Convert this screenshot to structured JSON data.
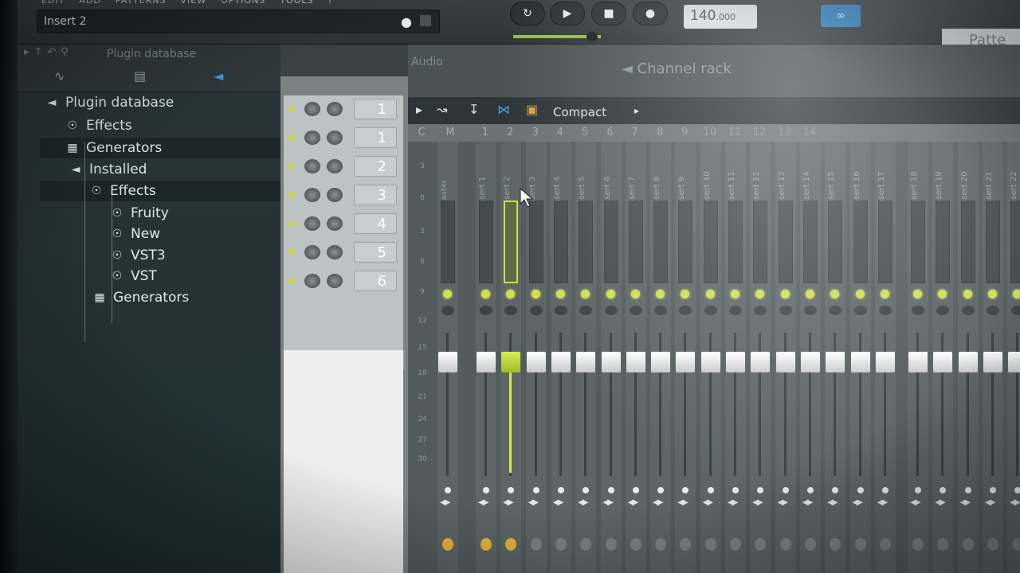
{
  "menu": [
    "EDIT",
    "ADD",
    "PATTERNS",
    "VIEW",
    "OPTIONS",
    "TOOLS",
    "?"
  ],
  "hint_bar": {
    "text": "Insert 2"
  },
  "transport": {
    "tempo": "140",
    "tempo_decimal": ".000"
  },
  "pattern_label": "Patte",
  "browser": {
    "title": "Plugin database",
    "tree": [
      {
        "label": "Plugin database",
        "icon": "speaker-icon",
        "level": 0
      },
      {
        "label": "Effects",
        "icon": "plug-icon",
        "level": 1
      },
      {
        "label": "Generators",
        "icon": "keyboard-icon",
        "level": 1
      },
      {
        "label": "Installed",
        "icon": "speaker-icon",
        "level": 1
      },
      {
        "label": "Effects",
        "icon": "plug-icon",
        "level": 2
      },
      {
        "label": "Fruity",
        "icon": "plug-icon",
        "level": 3
      },
      {
        "label": "New",
        "icon": "plug-icon",
        "level": 3
      },
      {
        "label": "VST3",
        "icon": "plug-icon",
        "level": 3
      },
      {
        "label": "VST",
        "icon": "plug-icon",
        "level": 3
      },
      {
        "label": "Generators",
        "icon": "keyboard-icon",
        "level": 2
      }
    ]
  },
  "channel_list": {
    "rows": [
      "1",
      "1",
      "2",
      "3",
      "4",
      "5",
      "6"
    ]
  },
  "mixer": {
    "header_audio": "Audio",
    "header_channel_rack": "Channel rack",
    "toolbar_label": "Compact",
    "col_headers": [
      "C",
      "M"
    ],
    "numbers": [
      "1",
      "2",
      "3",
      "4",
      "5",
      "6",
      "7",
      "8",
      "9",
      "10",
      "11",
      "12",
      "13",
      "14"
    ],
    "strips": [
      "Master",
      "Insert 1",
      "Insert 2",
      "Insert 3",
      "Insert 4",
      "Insert 5",
      "Insert 6",
      "Insert 7",
      "Insert 8",
      "Insert 9",
      "Insert 10",
      "Insert 11",
      "Insert 12",
      "Insert 13",
      "Insert 14",
      "Insert 15",
      "Insert 16",
      "Insert 17",
      "Insert 18",
      "Insert 19",
      "Insert 20",
      "Insert 21",
      "Insert 22"
    ],
    "selected_strip": "Insert 2",
    "scale": [
      "3",
      "0",
      "3",
      "6",
      "9",
      "12",
      "15",
      "18",
      "21",
      "24",
      "27",
      "30"
    ]
  },
  "colors": {
    "accent_green": "#c7e23d",
    "link_blue": "#2b7fbf"
  }
}
